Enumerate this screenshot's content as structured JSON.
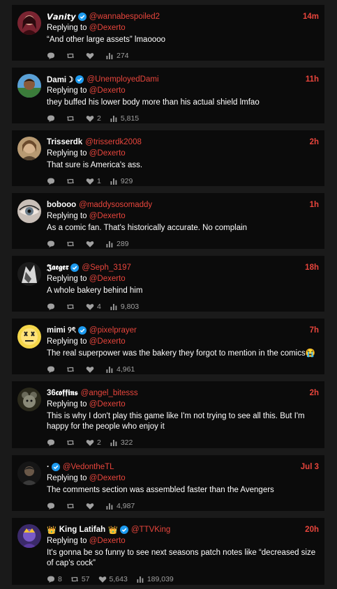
{
  "replying_prefix": "Replying to ",
  "colors": {
    "accent": "#e8453c",
    "verified": "#1d9bf0",
    "background": "#1a1a1a",
    "card": "#0b0b0b"
  },
  "tweets": [
    {
      "name": "𝙑𝙖𝙣𝙞𝙩𝙮",
      "handle": "@wannabespoiled2",
      "time": "14m",
      "replying_to": "@Dexerto",
      "text": "“And other large assets” lmaoooo",
      "replies": "",
      "retweets": "",
      "likes": "",
      "views": "274"
    },
    {
      "name": "Dami☽",
      "handle": "@UnemployedDami",
      "time": "11h",
      "replying_to": "@Dexerto",
      "text": "they buffed his lower body more than his actual shield lmfao",
      "replies": "",
      "retweets": "",
      "likes": "2",
      "views": "5,815"
    },
    {
      "name": "Trisserdk",
      "handle": "@trisserdk2008",
      "time": "2h",
      "replying_to": "@Dexerto",
      "text": "That sure is America's ass.",
      "replies": "",
      "retweets": "",
      "likes": "1",
      "views": "929"
    },
    {
      "name": "boboоо",
      "handle": "@maddysosomaddy",
      "time": "1h",
      "replying_to": "@Dexerto",
      "text": "As a comic fan. That's historically accurate. No complain",
      "replies": "",
      "retweets": "",
      "likes": "",
      "views": "289"
    },
    {
      "name": "𝕵𝖆𝖊𝖌𝖊𝖗",
      "handle": "@Seph_3197",
      "time": "18h",
      "replying_to": "@Dexerto",
      "text": "A whole bakery behind him",
      "replies": "",
      "retweets": "",
      "likes": "4",
      "views": "9,803"
    },
    {
      "name": "mimi ୨ৎ",
      "handle": "@pixelprayer",
      "time": "7h",
      "replying_to": "@Dexerto",
      "text": "The real superpower was the bakery they forgot to mention in the comics😭",
      "replies": "",
      "retweets": "",
      "likes": "",
      "views": "4,961"
    },
    {
      "name": "36𝖈𝖔𝖋𝖋𝖎𝖓𝖘",
      "handle": "@angel_bitesss",
      "time": "2h",
      "replying_to": "@Dexerto",
      "text": "This is why I don't play this game like I'm not trying to see all this. But I'm happy for the people who enjoy it",
      "replies": "",
      "retweets": "",
      "likes": "2",
      "views": "322"
    },
    {
      "name": "·",
      "handle": "@VedontheTL",
      "time": "Jul 3",
      "replying_to": "@Dexerto",
      "text": "The comments section was assembled faster than the Avengers",
      "replies": "",
      "retweets": "",
      "likes": "",
      "views": "4,987"
    },
    {
      "name": "King Latifah",
      "handle": "@TTVKing",
      "time": "20h",
      "replying_to": "@Dexerto",
      "text": "It's gonna be so funny to see next seasons patch notes like “decreased size of cap's cock”",
      "replies": "8",
      "retweets": "57",
      "likes": "5,643",
      "views": "189,039"
    }
  ]
}
